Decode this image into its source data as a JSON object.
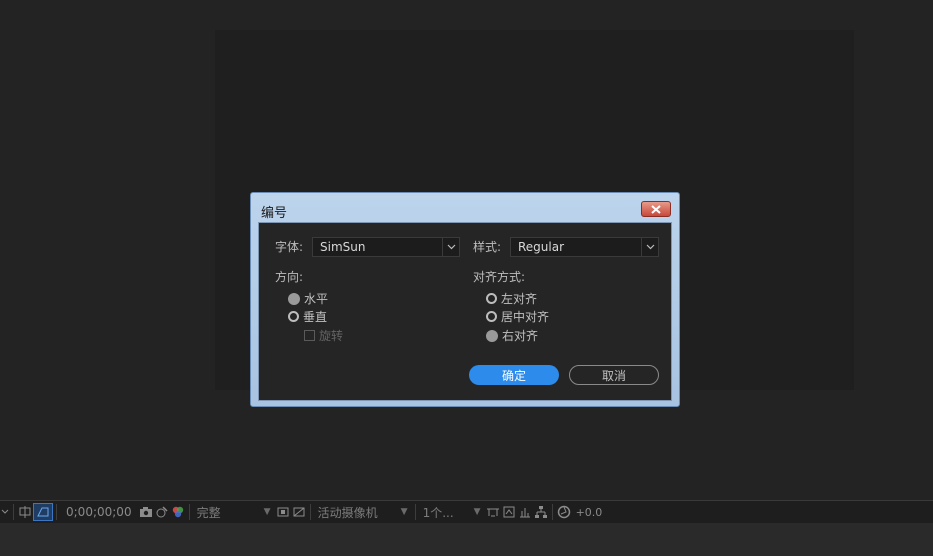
{
  "dialog": {
    "title": "编号",
    "font_label": "字体:",
    "font_value": "SimSun",
    "style_label": "样式:",
    "style_value": "Regular",
    "direction_label": "方向:",
    "direction_options": [
      {
        "label": "水平",
        "selected": true,
        "enabled": true
      },
      {
        "label": "垂直",
        "selected": false,
        "enabled": true
      }
    ],
    "rotate_label": "旋转",
    "rotate_checked": false,
    "alignment_label": "对齐方式:",
    "alignment_options": [
      {
        "label": "左对齐",
        "selected": false
      },
      {
        "label": "居中对齐",
        "selected": false
      },
      {
        "label": "右对齐",
        "selected": true
      }
    ],
    "ok_label": "确定",
    "cancel_label": "取消"
  },
  "toolbar": {
    "timecode": "0;00;00;00",
    "resolution": "完整",
    "camera": "活动摄像机",
    "views": "1个...",
    "exposure": "+0.0"
  },
  "colors": {
    "accent": "#2d8ceb",
    "title_bar": "#b6cfea",
    "close_button": "#d2594a",
    "panel_bg": "#252525"
  }
}
